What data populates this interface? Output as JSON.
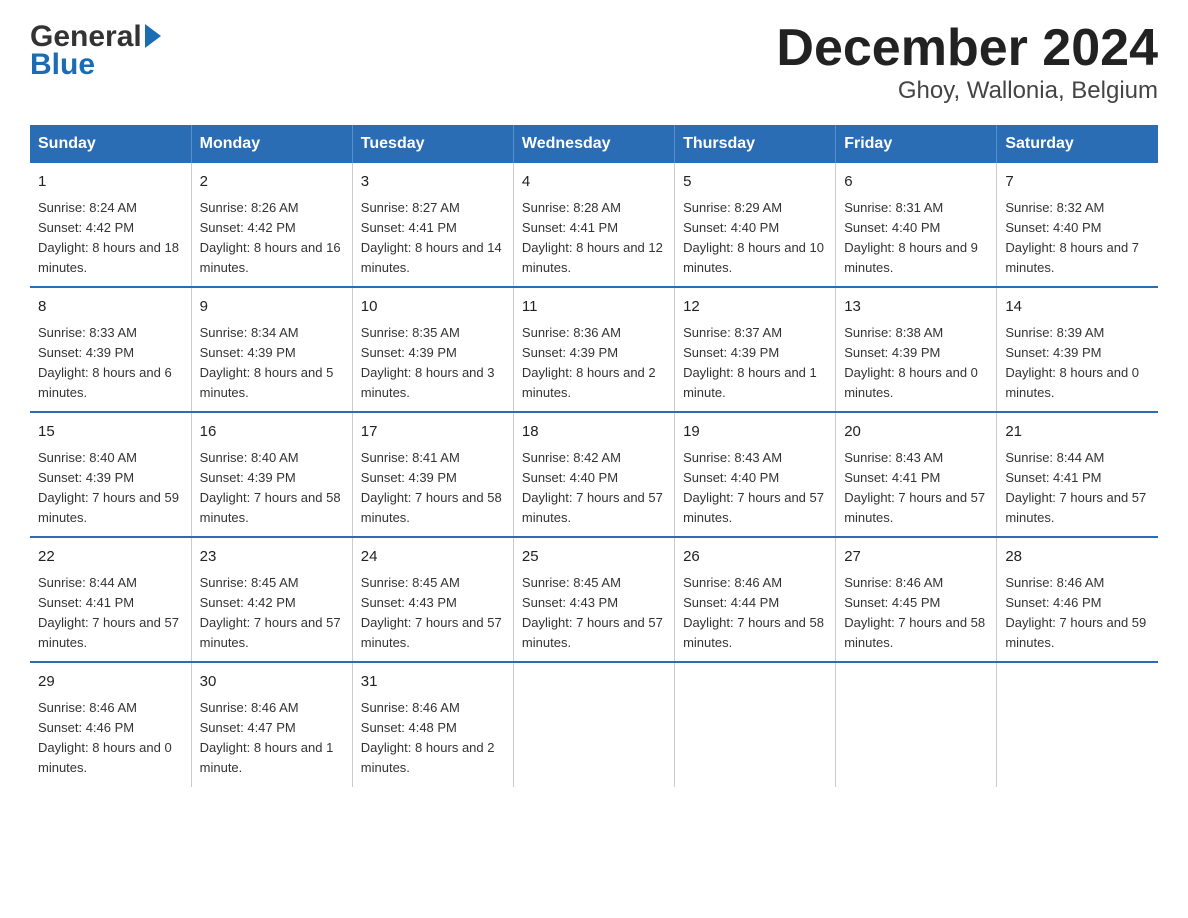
{
  "header": {
    "title": "December 2024",
    "subtitle": "Ghoy, Wallonia, Belgium",
    "logo_general": "General",
    "logo_blue": "Blue"
  },
  "columns": [
    "Sunday",
    "Monday",
    "Tuesday",
    "Wednesday",
    "Thursday",
    "Friday",
    "Saturday"
  ],
  "weeks": [
    [
      {
        "day": "1",
        "sunrise": "8:24 AM",
        "sunset": "4:42 PM",
        "daylight": "8 hours and 18 minutes."
      },
      {
        "day": "2",
        "sunrise": "8:26 AM",
        "sunset": "4:42 PM",
        "daylight": "8 hours and 16 minutes."
      },
      {
        "day": "3",
        "sunrise": "8:27 AM",
        "sunset": "4:41 PM",
        "daylight": "8 hours and 14 minutes."
      },
      {
        "day": "4",
        "sunrise": "8:28 AM",
        "sunset": "4:41 PM",
        "daylight": "8 hours and 12 minutes."
      },
      {
        "day": "5",
        "sunrise": "8:29 AM",
        "sunset": "4:40 PM",
        "daylight": "8 hours and 10 minutes."
      },
      {
        "day": "6",
        "sunrise": "8:31 AM",
        "sunset": "4:40 PM",
        "daylight": "8 hours and 9 minutes."
      },
      {
        "day": "7",
        "sunrise": "8:32 AM",
        "sunset": "4:40 PM",
        "daylight": "8 hours and 7 minutes."
      }
    ],
    [
      {
        "day": "8",
        "sunrise": "8:33 AM",
        "sunset": "4:39 PM",
        "daylight": "8 hours and 6 minutes."
      },
      {
        "day": "9",
        "sunrise": "8:34 AM",
        "sunset": "4:39 PM",
        "daylight": "8 hours and 5 minutes."
      },
      {
        "day": "10",
        "sunrise": "8:35 AM",
        "sunset": "4:39 PM",
        "daylight": "8 hours and 3 minutes."
      },
      {
        "day": "11",
        "sunrise": "8:36 AM",
        "sunset": "4:39 PM",
        "daylight": "8 hours and 2 minutes."
      },
      {
        "day": "12",
        "sunrise": "8:37 AM",
        "sunset": "4:39 PM",
        "daylight": "8 hours and 1 minute."
      },
      {
        "day": "13",
        "sunrise": "8:38 AM",
        "sunset": "4:39 PM",
        "daylight": "8 hours and 0 minutes."
      },
      {
        "day": "14",
        "sunrise": "8:39 AM",
        "sunset": "4:39 PM",
        "daylight": "8 hours and 0 minutes."
      }
    ],
    [
      {
        "day": "15",
        "sunrise": "8:40 AM",
        "sunset": "4:39 PM",
        "daylight": "7 hours and 59 minutes."
      },
      {
        "day": "16",
        "sunrise": "8:40 AM",
        "sunset": "4:39 PM",
        "daylight": "7 hours and 58 minutes."
      },
      {
        "day": "17",
        "sunrise": "8:41 AM",
        "sunset": "4:39 PM",
        "daylight": "7 hours and 58 minutes."
      },
      {
        "day": "18",
        "sunrise": "8:42 AM",
        "sunset": "4:40 PM",
        "daylight": "7 hours and 57 minutes."
      },
      {
        "day": "19",
        "sunrise": "8:43 AM",
        "sunset": "4:40 PM",
        "daylight": "7 hours and 57 minutes."
      },
      {
        "day": "20",
        "sunrise": "8:43 AM",
        "sunset": "4:41 PM",
        "daylight": "7 hours and 57 minutes."
      },
      {
        "day": "21",
        "sunrise": "8:44 AM",
        "sunset": "4:41 PM",
        "daylight": "7 hours and 57 minutes."
      }
    ],
    [
      {
        "day": "22",
        "sunrise": "8:44 AM",
        "sunset": "4:41 PM",
        "daylight": "7 hours and 57 minutes."
      },
      {
        "day": "23",
        "sunrise": "8:45 AM",
        "sunset": "4:42 PM",
        "daylight": "7 hours and 57 minutes."
      },
      {
        "day": "24",
        "sunrise": "8:45 AM",
        "sunset": "4:43 PM",
        "daylight": "7 hours and 57 minutes."
      },
      {
        "day": "25",
        "sunrise": "8:45 AM",
        "sunset": "4:43 PM",
        "daylight": "7 hours and 57 minutes."
      },
      {
        "day": "26",
        "sunrise": "8:46 AM",
        "sunset": "4:44 PM",
        "daylight": "7 hours and 58 minutes."
      },
      {
        "day": "27",
        "sunrise": "8:46 AM",
        "sunset": "4:45 PM",
        "daylight": "7 hours and 58 minutes."
      },
      {
        "day": "28",
        "sunrise": "8:46 AM",
        "sunset": "4:46 PM",
        "daylight": "7 hours and 59 minutes."
      }
    ],
    [
      {
        "day": "29",
        "sunrise": "8:46 AM",
        "sunset": "4:46 PM",
        "daylight": "8 hours and 0 minutes."
      },
      {
        "day": "30",
        "sunrise": "8:46 AM",
        "sunset": "4:47 PM",
        "daylight": "8 hours and 1 minute."
      },
      {
        "day": "31",
        "sunrise": "8:46 AM",
        "sunset": "4:48 PM",
        "daylight": "8 hours and 2 minutes."
      },
      null,
      null,
      null,
      null
    ]
  ],
  "labels": {
    "sunrise": "Sunrise:",
    "sunset": "Sunset:",
    "daylight": "Daylight:"
  }
}
